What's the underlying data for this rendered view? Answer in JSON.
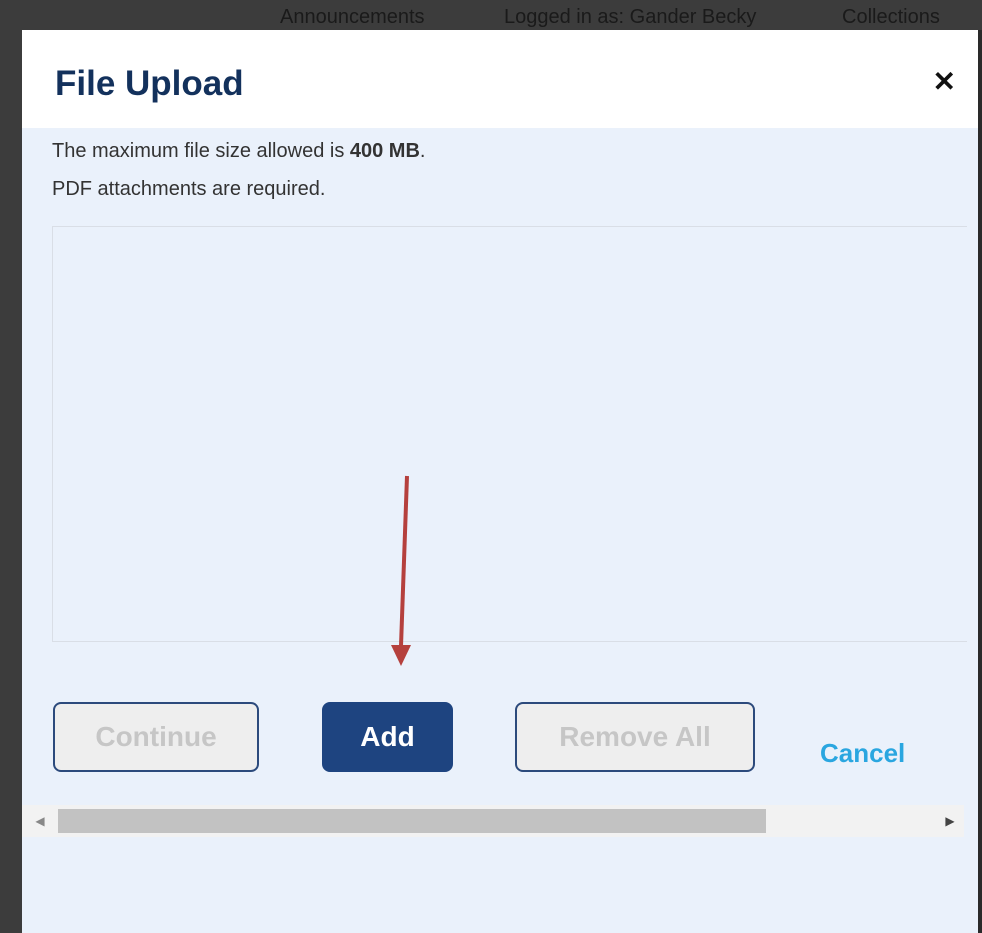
{
  "background": {
    "topbar": {
      "announcements": "Announcements",
      "logged_in": "Logged in as: Gander Becky",
      "collections": "Collections"
    }
  },
  "dialog": {
    "title": "File Upload",
    "close_icon": "close-icon",
    "max_size_prefix": "The maximum file size allowed is ",
    "max_size_value": "400 MB",
    "max_size_suffix": ".",
    "pdf_note": "PDF attachments are required.",
    "buttons": {
      "continue": "Continue",
      "add": "Add",
      "remove_all": "Remove All",
      "cancel": "Cancel"
    },
    "scrollbar": {
      "left_icon": "scroll-left-icon",
      "right_icon": "scroll-right-icon"
    }
  },
  "colors": {
    "title": "#13315c",
    "primary_button": "#1e4480",
    "cancel_link": "#2aa6e0",
    "dialog_bg": "#eaf1fb",
    "annotation_arrow": "#b5403d"
  }
}
